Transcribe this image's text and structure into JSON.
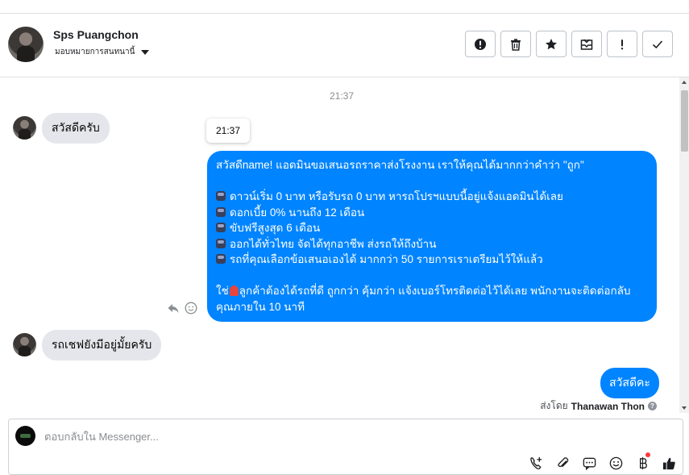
{
  "header": {
    "name": "Sps Puangchon",
    "assign_label": "มอบหมายการสนทนานี้"
  },
  "toolbar": {
    "buttons": [
      {
        "name": "mark-spam-button",
        "icon": "alert-circle-icon"
      },
      {
        "name": "delete-button",
        "icon": "trash-icon"
      },
      {
        "name": "star-button",
        "icon": "star-icon"
      },
      {
        "name": "mark-unread-button",
        "icon": "envelope-icon"
      },
      {
        "name": "follow-up-button",
        "icon": "exclamation-icon"
      },
      {
        "name": "mark-done-button",
        "icon": "check-icon"
      }
    ]
  },
  "chat": {
    "timestamp": "21:37",
    "tooltip_time": "21:37",
    "messages": [
      {
        "direction": "in",
        "text": "สวัสดีครับ"
      },
      {
        "direction": "out",
        "lines": [
          "สวัสดีname! แอดมินขอเสนอรถราคาส่งโรงงาน เราให้คุณได้มากกว่าคำว่า \"ถูก\"",
          "",
          "ดาวน์เริ่ม 0 บาท หรือรับรถ 0 บาท หารถโปรฯแบบนี้อยู่แจ้งแอดมินได้เลย",
          "ดอกเบี้ย 0% นานถึง 12 เดือน",
          "ขับฟรีสูงสุด 6 เดือน",
          "ออกได้ทั่วไทย จัดได้ทุกอาชีพ ส่งรถให้ถึงบ้าน",
          "รถที่คุณเลือกข้อเสนอเองได้ มากกว่า 50 รายการเราเตรียมไว้ให้แล้ว",
          "",
          "ใช่",
          "ลูกค้าต้องได้รถที่ดี ถูกกว่า คุ้มกว่า แจ้งเบอร์โทรติดต่อไว้ได้เลย พนักงานจะติดต่อกลับคุณภายใน 10 นาที"
        ]
      },
      {
        "direction": "in",
        "text": "รถเชฟยังมีอยู่มั้ยครับ"
      },
      {
        "direction": "out",
        "text": "สวัสดีคะ"
      }
    ],
    "sent_by_prefix": "ส่งโดย",
    "sent_by_name": "Thanawan Thon"
  },
  "composer": {
    "placeholder": "ตอบกลับใน Messenger..."
  },
  "colors": {
    "outgoing_bubble": "#0084ff",
    "incoming_bubble": "#e4e6eb"
  }
}
